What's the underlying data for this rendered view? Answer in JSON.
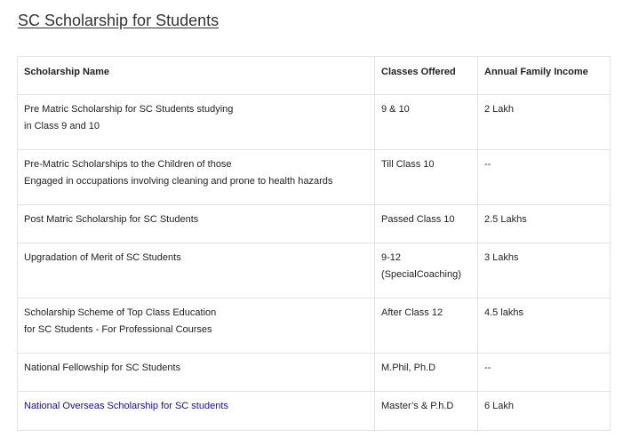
{
  "page": {
    "title": "SC Scholarship for Students"
  },
  "table": {
    "headers": [
      "Scholarship Name",
      "Classes Offered",
      "Annual Family Income"
    ],
    "rows": [
      {
        "name_lines": [
          "Pre Matric Scholarship for SC Students studying",
          "in Class 9 and 10"
        ],
        "classes_lines": [
          "9 & 10"
        ],
        "income": "2 Lakh"
      },
      {
        "name_lines": [
          "Pre-Matric Scholarships to the Children of those",
          "Engaged in occupations involving cleaning and prone to health hazards"
        ],
        "classes_lines": [
          "Till Class 10"
        ],
        "income": "--"
      },
      {
        "name_lines": [
          "Post Matric Scholarship for SC Students"
        ],
        "classes_lines": [
          "Passed Class 10"
        ],
        "income": "2.5 Lakhs"
      },
      {
        "name_lines": [
          "Upgradation of Merit of SC Students"
        ],
        "classes_lines": [
          "9-12",
          "(SpecialCoaching)"
        ],
        "income": "3 Lakhs"
      },
      {
        "name_lines": [
          "Scholarship Scheme of Top Class Education",
          "for SC Students - For Professional Courses"
        ],
        "classes_lines": [
          "After Class 12"
        ],
        "income": "4.5 lakhs"
      },
      {
        "name_lines": [
          "National Fellowship for SC Students"
        ],
        "classes_lines": [
          "M.Phil, Ph.D"
        ],
        "income": "--"
      },
      {
        "name_lines": [
          "National Overseas Scholarship for SC students"
        ],
        "classes_lines": [
          "Master’s & P.h.D"
        ],
        "income": "6 Lakh",
        "is_link": true
      }
    ]
  },
  "colors": {
    "link": "#1a0dab",
    "border": "#e3e3e3",
    "text": "#222222"
  }
}
